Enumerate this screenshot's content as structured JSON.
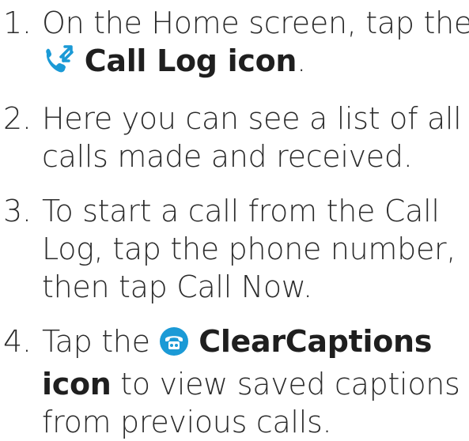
{
  "steps": [
    {
      "number": "1.",
      "line1": "On the Home screen, tap the",
      "icon": "call-log-icon",
      "bold": "Call Log icon",
      "after": "."
    },
    {
      "number": "2.",
      "line1": "Here you can see a list of all",
      "line2": "calls made and received."
    },
    {
      "number": "3.",
      "line1": "To start a call from the Call",
      "line2": "Log, tap the phone number,",
      "line3": "then tap Call Now."
    },
    {
      "number": "4.",
      "before": "Tap the",
      "icon": "clearcaptions-icon",
      "bold1": "ClearCaptions",
      "bold2": "icon",
      "rest2": "to view saved captions",
      "line3": "from previous calls."
    }
  ],
  "colors": {
    "text": "#2b2b2b",
    "icon_blue": "#1b9ad6"
  }
}
